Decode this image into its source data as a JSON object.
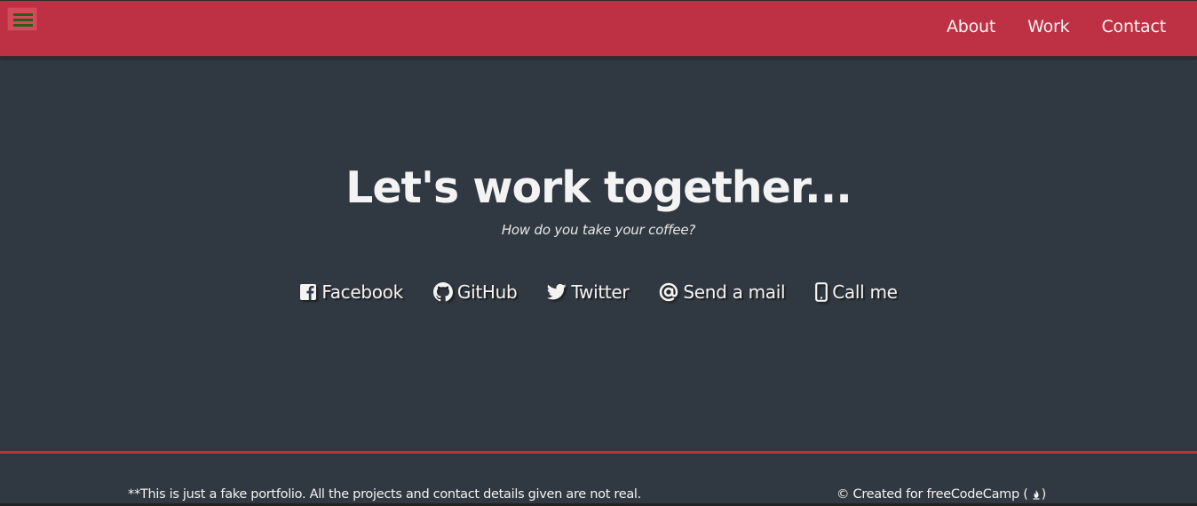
{
  "navbar": {
    "menu_icon": "hamburger-menu-icon",
    "links": [
      "About",
      "Work",
      "Contact"
    ]
  },
  "hero": {
    "title": "Let's work together...",
    "subtitle": "How do you take your coffee?"
  },
  "contact_links": [
    {
      "label": "Facebook",
      "icon": "facebook-icon"
    },
    {
      "label": "GitHub",
      "icon": "github-icon"
    },
    {
      "label": "Twitter",
      "icon": "twitter-icon"
    },
    {
      "label": "Send a mail",
      "icon": "at-sign-icon"
    },
    {
      "label": "Call me",
      "icon": "mobile-phone-icon"
    }
  ],
  "footer": {
    "disclaimer": "**This is just a fake portfolio. All the projects and contact details given are not real.",
    "credit": "© Created for freeCodeCamp (",
    "credit_icon": "freecodecamp-fire-icon",
    "credit_end": ")"
  },
  "colors": {
    "accent": "#be3144",
    "background": "#303841",
    "text": "#f3f3f3",
    "menu_bars": "#2f5a1a"
  }
}
